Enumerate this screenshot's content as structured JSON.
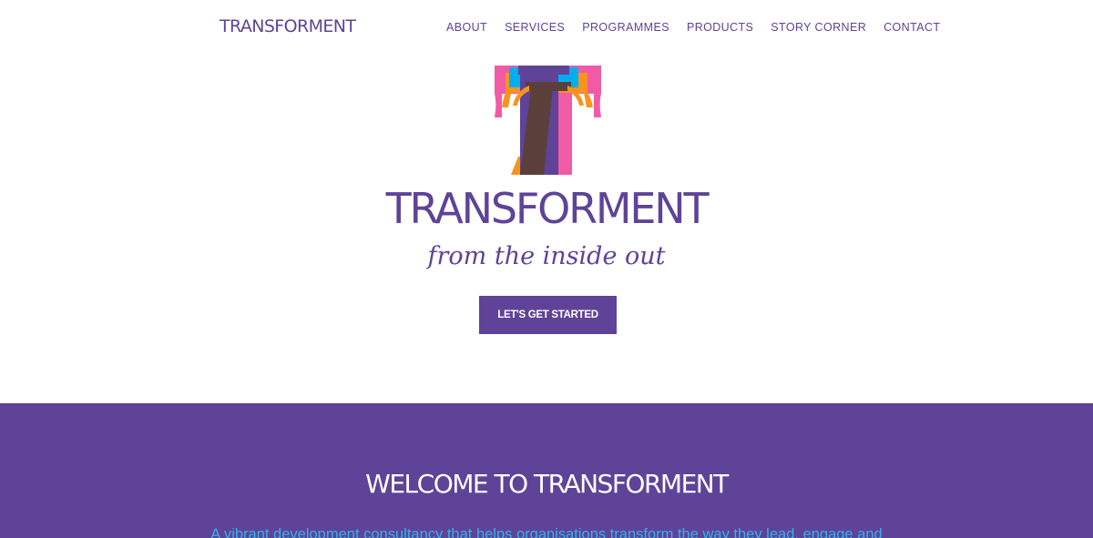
{
  "header": {
    "brand": "TRANSFORMENT",
    "nav": [
      {
        "label": "ABOUT"
      },
      {
        "label": "SERVICES"
      },
      {
        "label": "PROGRAMMES"
      },
      {
        "label": "PRODUCTS"
      },
      {
        "label": "STORY CORNER"
      },
      {
        "label": "CONTACT"
      }
    ]
  },
  "hero": {
    "logo_icon": "transforment-t-logo-icon",
    "title": "TRANSFORMENT",
    "tagline": "from the inside out",
    "cta_label": "LET'S GET STARTED"
  },
  "welcome": {
    "title": "WELCOME TO TRANSFORMENT",
    "text": "A vibrant development consultancy that helps organisations transform the way they lead, engage and"
  },
  "colors": {
    "brand_purple": "#5e4398",
    "accent_blue": "#35b1ea",
    "logo_pink": "#f15ba5",
    "logo_orange": "#f7941d",
    "logo_cyan": "#00aeef",
    "logo_brown": "#5b3f3a",
    "background": "#ffffff"
  }
}
